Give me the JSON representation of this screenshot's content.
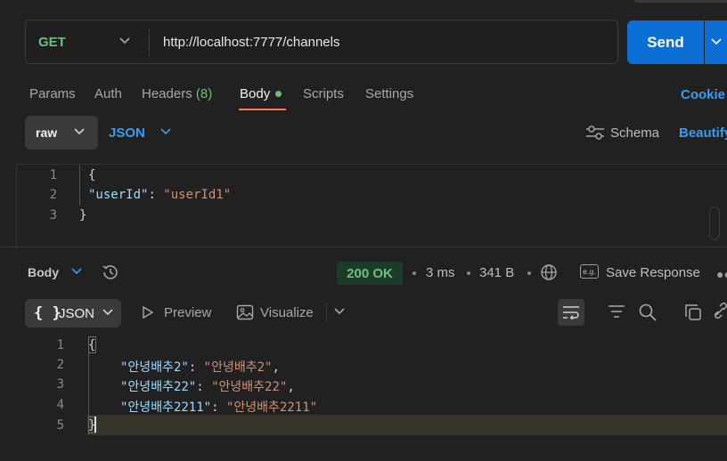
{
  "request": {
    "method": "GET",
    "url": "http://localhost:7777/channels",
    "send_label": "Send"
  },
  "tabs": [
    {
      "label": "Params"
    },
    {
      "label": "Auth"
    },
    {
      "label": "Headers",
      "badge": "(8)"
    },
    {
      "label": "Body",
      "active": true
    },
    {
      "label": "Scripts"
    },
    {
      "label": "Settings"
    }
  ],
  "cookies_label": "Cookie",
  "body_mode": {
    "mode": "raw",
    "format": "JSON",
    "schema_label": "Schema",
    "beautify_label": "Beautify"
  },
  "request_body": {
    "line_numbers": [
      "1",
      "2",
      "3"
    ],
    "open_brace": "{",
    "key": "\"userId\"",
    "colon": ": ",
    "value": "\"userId1\"",
    "close_brace": "}"
  },
  "response": {
    "body_label": "Body",
    "status": "200 OK",
    "time": "3 ms",
    "size": "341 B",
    "save_label": "Save Response",
    "format": "JSON",
    "braces": "{ }",
    "preview_label": "Preview",
    "visualize_label": "Visualize",
    "eg_label": "e.g.",
    "line_numbers": [
      "1",
      "2",
      "3",
      "4",
      "5"
    ],
    "open_brace": "{",
    "close_brace": "}",
    "entries": [
      {
        "key": "\"안녕배추2\"",
        "value": "\"안녕배추2\"",
        "comma": ","
      },
      {
        "key": "\"안녕배추22\"",
        "value": "\"안녕배추22\"",
        "comma": ","
      },
      {
        "key": "\"안녕배추2211\"",
        "value": "\"안녕배추2211\"",
        "comma": ""
      }
    ]
  },
  "colors": {
    "accent_tab": "#ff7a45",
    "send": "#0b6fd6",
    "status_ok": "#6cbf7c",
    "link": "#3b9cf3"
  }
}
